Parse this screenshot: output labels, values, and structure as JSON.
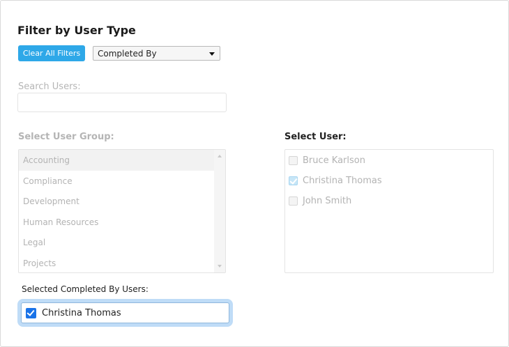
{
  "filter": {
    "title": "Filter by User Type",
    "clear_button_label": "Clear All Filters",
    "type_select_value": "Completed By"
  },
  "search": {
    "label": "Search Users:",
    "value": ""
  },
  "user_group": {
    "label": "Select User Group:",
    "items": [
      {
        "label": "Accounting"
      },
      {
        "label": "Compliance"
      },
      {
        "label": "Development"
      },
      {
        "label": "Human Resources"
      },
      {
        "label": "Legal"
      },
      {
        "label": "Projects"
      }
    ]
  },
  "users": {
    "label": "Select User:",
    "items": [
      {
        "label": "Bruce Karlson",
        "checked": false
      },
      {
        "label": "Christina Thomas",
        "checked": true
      },
      {
        "label": "John Smith",
        "checked": false
      }
    ]
  },
  "selected": {
    "label": "Selected Completed By Users:",
    "items": [
      {
        "label": "Christina Thomas",
        "checked": true
      }
    ]
  },
  "colors": {
    "accent": "#2ea8e8",
    "checkbox_blue": "#1a73e8",
    "selected_glow": "#bfdcf7"
  }
}
